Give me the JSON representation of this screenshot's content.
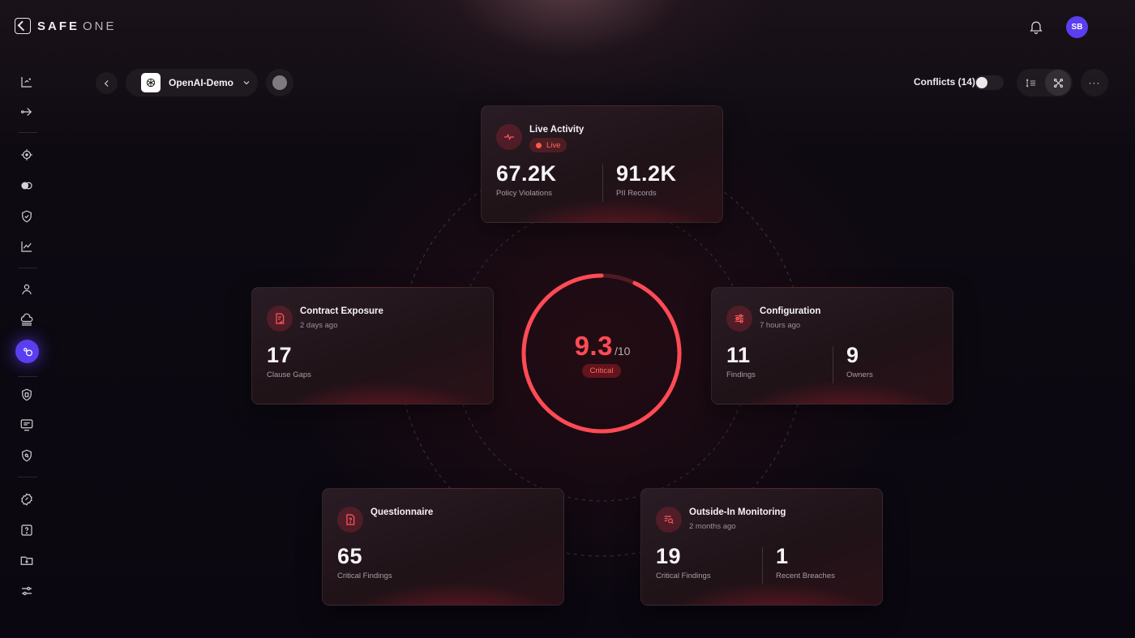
{
  "brand": {
    "name_bold": "SAFE",
    "name_light": "ONE"
  },
  "header": {
    "avatar_initials": "SB"
  },
  "toolbar": {
    "project_name": "OpenAI-Demo",
    "conflicts_label": "Conflicts (14)",
    "more_label": "···"
  },
  "gauge": {
    "score": "9.3",
    "max": "/10",
    "status": "Critical",
    "fraction": 0.93,
    "color": "#ff4b55"
  },
  "cards": {
    "live": {
      "title": "Live Activity",
      "badge": "Live",
      "m1_value": "67.2K",
      "m1_label": "Policy Violations",
      "m2_value": "91.2K",
      "m2_label": "PII Records"
    },
    "contract": {
      "title": "Contract Exposure",
      "sub": "2 days ago",
      "m1_value": "17",
      "m1_label": "Clause Gaps"
    },
    "config": {
      "title": "Configuration",
      "sub": "7 hours ago",
      "m1_value": "11",
      "m1_label": "Findings",
      "m2_value": "9",
      "m2_label": "Owners"
    },
    "questionnaire": {
      "title": "Questionnaire",
      "m1_value": "65",
      "m1_label": "Critical Findings"
    },
    "outside": {
      "title": "Outside-In Monitoring",
      "sub": "2 months ago",
      "m1_value": "19",
      "m1_label": "Critical Findings",
      "m2_value": "1",
      "m2_label": "Recent Breaches"
    }
  },
  "sidebar_icons": [
    "analytics-icon",
    "share-nodes-icon",
    "target-icon",
    "toggle-circles-icon",
    "shield-check-icon",
    "line-chart-icon",
    "user-icon",
    "cloud-icon",
    "bubbles-icon",
    "document-shield-icon",
    "terminal-icon",
    "shield-search-icon",
    "gear-badge-icon",
    "help-icon",
    "folder-download-icon",
    "sliders-icon"
  ],
  "colors": {
    "accent": "#5a3ff0",
    "critical": "#ff4b55",
    "background": "#0c0811"
  }
}
